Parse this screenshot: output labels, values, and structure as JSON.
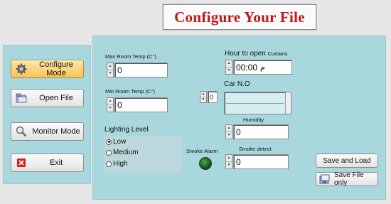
{
  "title": "Configure Your File",
  "sidebar": {
    "items": [
      {
        "label": "Configure Mode",
        "icon": "gear-icon",
        "active": true
      },
      {
        "label": "Open File",
        "icon": "folder-icon",
        "active": false
      },
      {
        "label": "Monitor Mode",
        "icon": "magnifier-icon",
        "active": false
      },
      {
        "label": "Exit",
        "icon": "close-icon",
        "active": false
      }
    ]
  },
  "fields": {
    "max_room_temp": {
      "label": "Max Room  Temp (C°)",
      "value": "0"
    },
    "min_room_temp": {
      "label": "Min Room  Temp (C°)",
      "value": "0"
    },
    "hour_to_open": {
      "label_main": "Hour to open",
      "label_small": "Curtains",
      "value": "00:00",
      "suffix": "م"
    },
    "car_no": {
      "label": "Car N.O",
      "index": "0"
    },
    "humidity": {
      "label": "Humidity",
      "value": "0"
    },
    "smoke_detect": {
      "label": "Smoke detect",
      "value": "0"
    }
  },
  "lighting": {
    "label": "Lighting Level",
    "options": [
      "Low",
      "Medium",
      "High"
    ],
    "selected": "Low"
  },
  "smoke_alarm": {
    "label": "Smoke  Alarm",
    "color": "#1f6b1f"
  },
  "buttons": {
    "save_and_load": "Save and Load",
    "save_file_only": "Save File only"
  },
  "colors": {
    "panel": "#a9d7de",
    "title": "#c41616",
    "active": "#f6c35a"
  }
}
